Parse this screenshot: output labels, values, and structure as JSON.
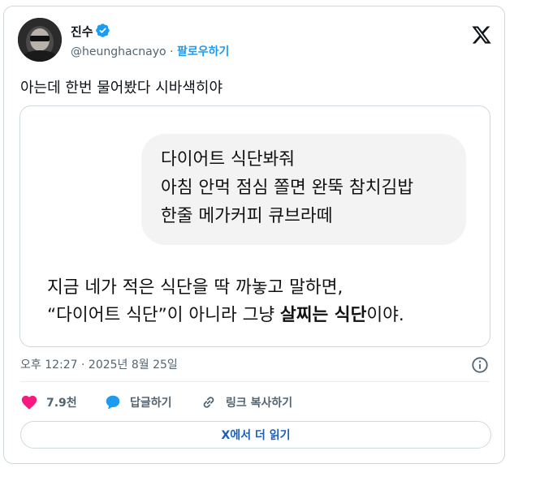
{
  "author": {
    "display_name": "진수",
    "handle": "@heunghacnayo",
    "separator": " · ",
    "follow_label": "팔로우하기"
  },
  "tweet": {
    "text": "아는데 한번 물어봤다 시바색히야"
  },
  "media": {
    "question_lines": [
      "다이어트 식단봐줘",
      "아침 안먹 점심 쫄면 완뚝 참치김밥",
      "한줄 메가커피 큐브라떼"
    ],
    "answer_line1": "지금 네가 적은 식단을 딱 까놓고 말하면,",
    "answer_line2_part1": "“다이어트 식단”이 아니라 그냥 ",
    "answer_line2_bold": "살찌는 식단",
    "answer_line2_part2": "이야."
  },
  "meta": {
    "timestamp": "오후 12:27 · 2025년 8월 25일"
  },
  "actions": {
    "like_count": "7.9천",
    "reply_label": "답글하기",
    "copy_link_label": "링크 복사하기"
  },
  "read_more_label": "X에서 더 읽기",
  "colors": {
    "like": "#f91880",
    "reply": "#1d9bf0",
    "link": "#1d9bf0",
    "verified": "#1d9bf0"
  },
  "icons": [
    "avatar",
    "verified-badge-icon",
    "x-logo-icon",
    "info-icon",
    "heart-icon",
    "reply-bubble-icon",
    "link-icon"
  ]
}
